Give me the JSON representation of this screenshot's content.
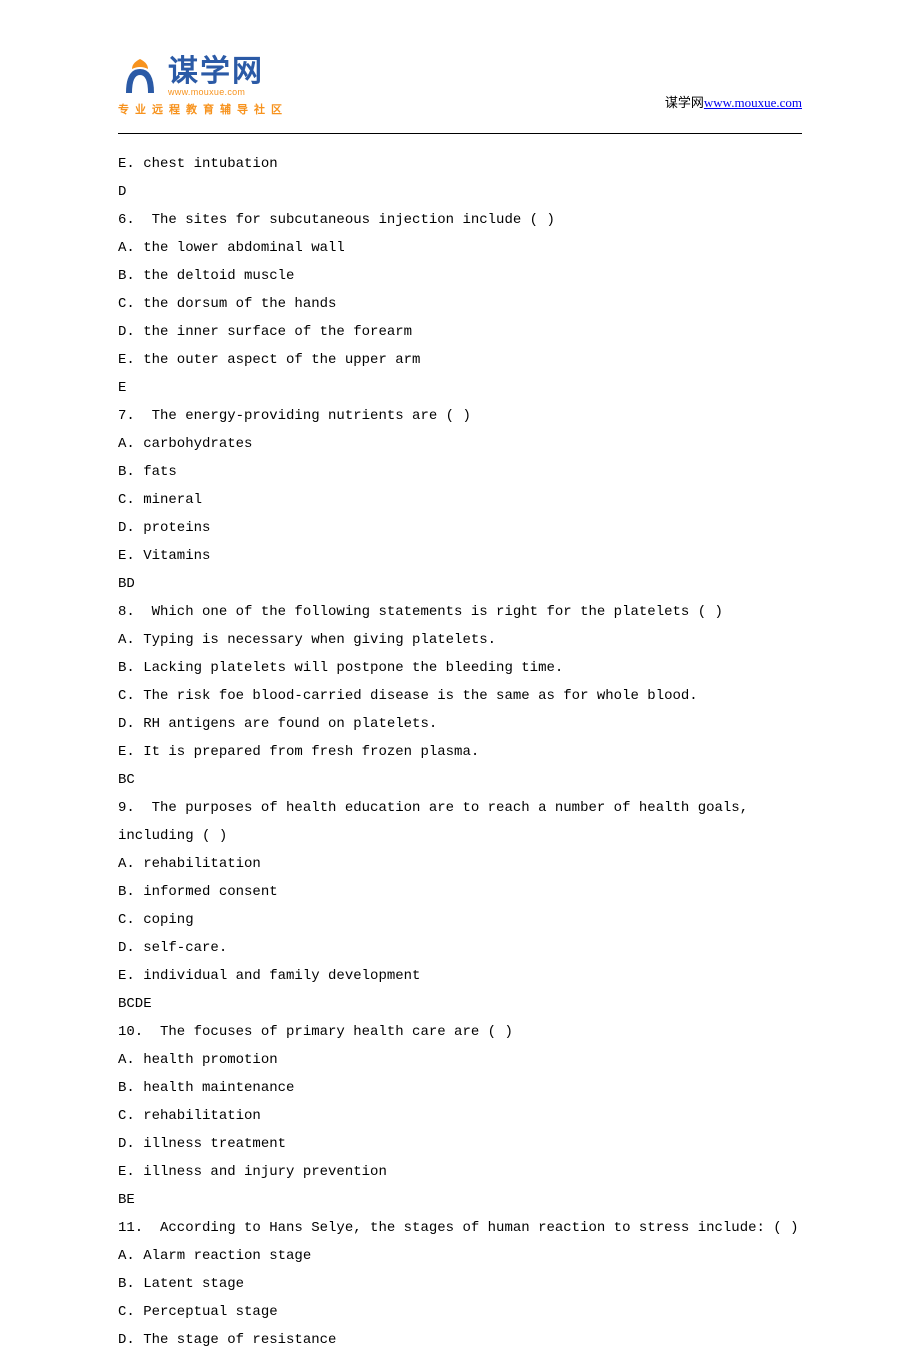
{
  "header": {
    "logo_title": "谋学网",
    "logo_url": "www.mouxue.com",
    "logo_tagline": "专业远程教育辅导社区",
    "site_label": "谋学网",
    "site_link": "www.mouxue.com"
  },
  "lines": [
    "E. chest intubation",
    "D",
    "6.  The sites for subcutaneous injection include ( )",
    "A. the lower abdominal wall",
    "B. the deltoid muscle",
    "C. the dorsum of the hands",
    "D. the inner surface of the forearm",
    "E. the outer aspect of the upper arm",
    "E",
    "7.  The energy-providing nutrients are ( )",
    "A. carbohydrates",
    "B. fats",
    "C. mineral",
    "D. proteins",
    "E. Vitamins",
    "BD",
    "8.  Which one of the following statements is right for the platelets ( )",
    "A. Typing is necessary when giving platelets.",
    "B. Lacking platelets will postpone the bleeding time.",
    "C. The risk foe blood-carried disease is the same as for whole blood.",
    "D. RH antigens are found on platelets.",
    "E. It is prepared from fresh frozen plasma.",
    "BC",
    "9.  The purposes of health education are to reach a number of health goals, including ( )",
    "A. rehabilitation",
    "B. informed consent",
    "C. coping",
    "D. self-care.",
    "E. individual and family development",
    "BCDE",
    "10.  The focuses of primary health care are ( )",
    "A. health promotion",
    "B. health maintenance",
    "C. rehabilitation",
    "D. illness treatment",
    "E. illness and injury prevention",
    "BE",
    "11.  According to Hans Selye, the stages of human reaction to stress include: ( )",
    "A. Alarm reaction stage",
    "B. Latent stage",
    "C. Perceptual stage",
    "D. The stage of resistance"
  ]
}
